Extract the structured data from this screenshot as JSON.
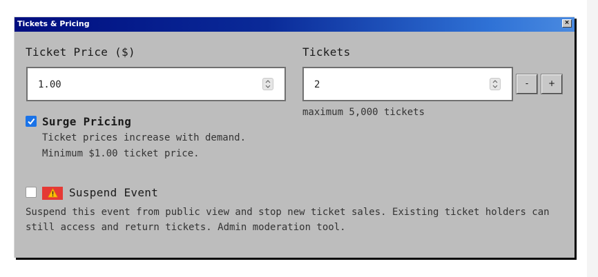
{
  "dialog": {
    "title": "Tickets & Pricing",
    "close_glyph": "×"
  },
  "price": {
    "label": "Ticket Price ($)",
    "value": "1.00",
    "spinner_glyph": "⌃⌄"
  },
  "tickets": {
    "label": "Tickets",
    "value": "2",
    "decrement_label": "-",
    "increment_label": "+",
    "hint": "maximum 5,000 tickets"
  },
  "surge": {
    "checked": true,
    "label": "Surge Pricing",
    "desc_line1": "Ticket prices increase with demand.",
    "desc_line2": "Minimum $1.00 ticket price."
  },
  "suspend": {
    "checked": false,
    "badge_icon": "warning-icon",
    "label": "Suspend Event",
    "desc_line1": "Suspend this event from public view and stop new ticket sales. Existing ticket holders can",
    "desc_line2": "still access and return tickets. Admin moderation tool."
  },
  "colors": {
    "titlebar_start": "#000e80",
    "titlebar_end": "#4a8ae0",
    "dialog_bg": "#bdbdbd",
    "checkbox_accent": "#1a73e8",
    "warning_badge": "#e53935"
  }
}
